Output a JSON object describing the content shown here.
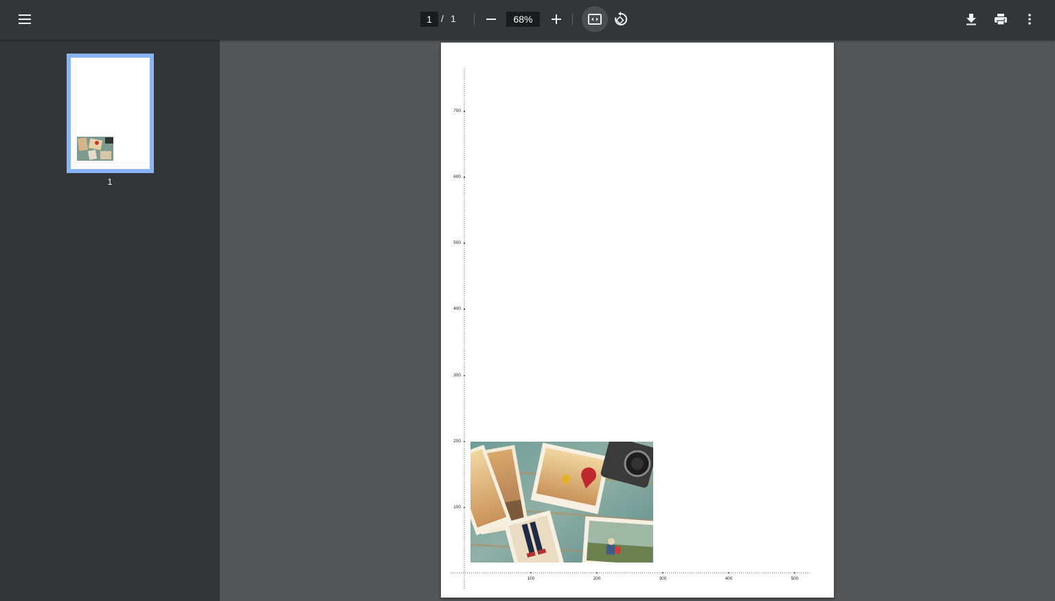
{
  "toolbar": {
    "page_current": "1",
    "page_separator": "/",
    "page_total": "1",
    "zoom_level": "68%"
  },
  "sidebar": {
    "thumbnails": [
      {
        "label": "1"
      }
    ]
  },
  "document": {
    "y_ticks": [
      "700",
      "600",
      "500",
      "400",
      "300",
      "200",
      "100"
    ],
    "x_ticks": [
      "100",
      "200",
      "300",
      "400",
      "500"
    ]
  }
}
